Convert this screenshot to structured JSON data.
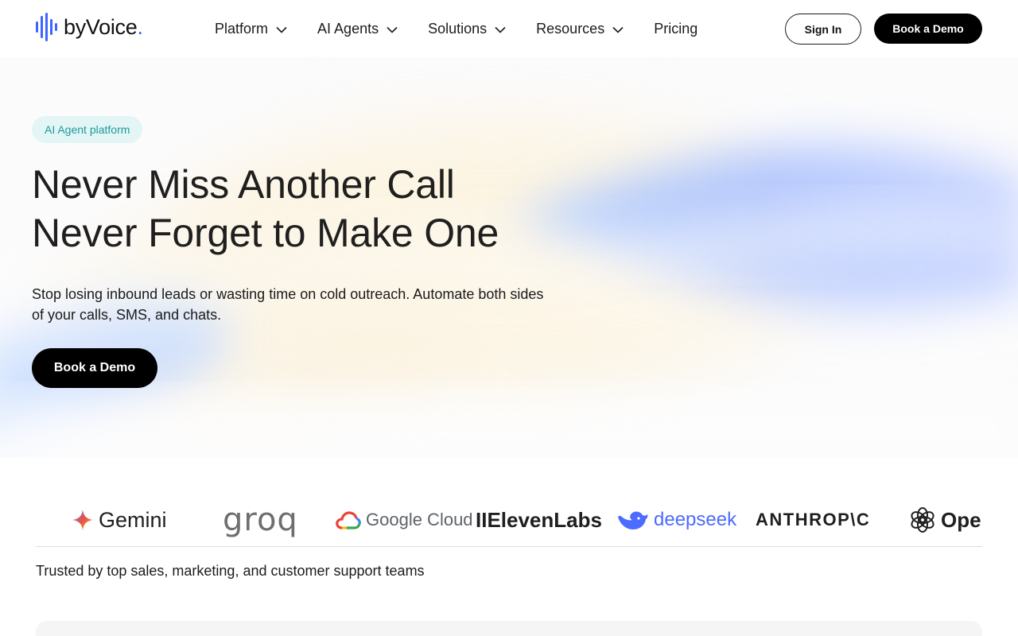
{
  "brand": {
    "name": "byVoice",
    "dot": ".",
    "accent": "#3f63ff"
  },
  "nav": {
    "items": [
      {
        "label": "Platform",
        "has_dropdown": true
      },
      {
        "label": "AI Agents",
        "has_dropdown": true
      },
      {
        "label": "Solutions",
        "has_dropdown": true
      },
      {
        "label": "Resources",
        "has_dropdown": true
      },
      {
        "label": "Pricing",
        "has_dropdown": false
      }
    ],
    "sign_in_label": "Sign In",
    "book_demo_label": "Book a Demo"
  },
  "hero": {
    "badge": "AI Agent platform",
    "headline_line1": "Never Miss Another Call",
    "headline_line2": "Never Forget to Make One",
    "subtext": "Stop losing inbound leads or wasting time on cold outreach. Automate both sides of your calls, SMS, and chats.",
    "cta_label": "Book a Demo"
  },
  "partners": {
    "gemini": "Gemini",
    "groq": "groq",
    "google_cloud": "Google Cloud",
    "elevenlabs": "IIElevenLabs",
    "deepseek": "deepseek",
    "anthropic": "ANTHROP\\C",
    "openai": "Open"
  },
  "trusted_text": "Trusted by top sales, marketing, and customer support teams"
}
